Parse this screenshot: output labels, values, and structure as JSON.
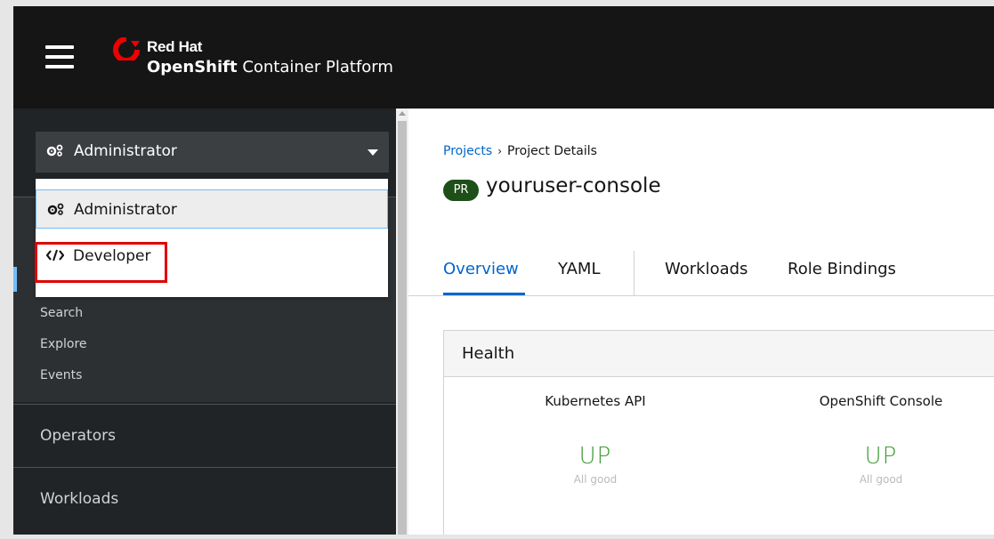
{
  "masthead": {
    "brand_line1": "Red Hat",
    "brand_line2_bold": "OpenShift",
    "brand_line2_rest": " Container Platform",
    "logo_color": "#ee0000"
  },
  "sidebar": {
    "perspective": "Administrator",
    "menu": {
      "items": [
        {
          "label": "Administrator",
          "icon": "cogs-icon",
          "selected": true
        },
        {
          "label": "Developer",
          "icon": "code-icon",
          "selected": false
        }
      ]
    },
    "subnav": [
      "Search",
      "Explore",
      "Events"
    ],
    "groups": [
      "Operators",
      "Workloads"
    ]
  },
  "main": {
    "breadcrumb": {
      "link": "Projects",
      "separator": "›",
      "current": "Project Details"
    },
    "badge": "PR",
    "project_name": "youruser-console",
    "tabs": [
      "Overview",
      "YAML",
      "Workloads",
      "Role Bindings"
    ],
    "active_tab": "Overview",
    "health": {
      "title": "Health",
      "services": [
        {
          "name": "Kubernetes API",
          "status": "UP",
          "message": "All good"
        },
        {
          "name": "OpenShift Console",
          "status": "UP",
          "message": "All good"
        }
      ]
    }
  },
  "colors": {
    "accent": "#0066cc",
    "highlight": "#e00000",
    "status_up": "#3f9c35",
    "badge": "#1e4f18"
  }
}
